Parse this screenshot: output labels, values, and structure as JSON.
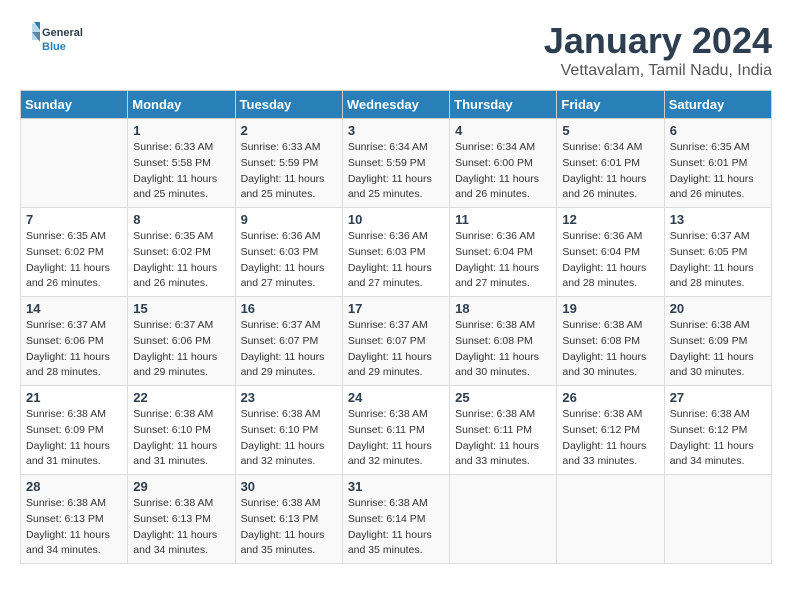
{
  "logo": {
    "general": "General",
    "blue": "Blue"
  },
  "title": "January 2024",
  "subtitle": "Vettavalam, Tamil Nadu, India",
  "days_header": [
    "Sunday",
    "Monday",
    "Tuesday",
    "Wednesday",
    "Thursday",
    "Friday",
    "Saturday"
  ],
  "weeks": [
    [
      {
        "day": "",
        "sunrise": "",
        "sunset": "",
        "daylight": ""
      },
      {
        "day": "1",
        "sunrise": "Sunrise: 6:33 AM",
        "sunset": "Sunset: 5:58 PM",
        "daylight": "Daylight: 11 hours and 25 minutes."
      },
      {
        "day": "2",
        "sunrise": "Sunrise: 6:33 AM",
        "sunset": "Sunset: 5:59 PM",
        "daylight": "Daylight: 11 hours and 25 minutes."
      },
      {
        "day": "3",
        "sunrise": "Sunrise: 6:34 AM",
        "sunset": "Sunset: 5:59 PM",
        "daylight": "Daylight: 11 hours and 25 minutes."
      },
      {
        "day": "4",
        "sunrise": "Sunrise: 6:34 AM",
        "sunset": "Sunset: 6:00 PM",
        "daylight": "Daylight: 11 hours and 26 minutes."
      },
      {
        "day": "5",
        "sunrise": "Sunrise: 6:34 AM",
        "sunset": "Sunset: 6:01 PM",
        "daylight": "Daylight: 11 hours and 26 minutes."
      },
      {
        "day": "6",
        "sunrise": "Sunrise: 6:35 AM",
        "sunset": "Sunset: 6:01 PM",
        "daylight": "Daylight: 11 hours and 26 minutes."
      }
    ],
    [
      {
        "day": "7",
        "sunrise": "Sunrise: 6:35 AM",
        "sunset": "Sunset: 6:02 PM",
        "daylight": "Daylight: 11 hours and 26 minutes."
      },
      {
        "day": "8",
        "sunrise": "Sunrise: 6:35 AM",
        "sunset": "Sunset: 6:02 PM",
        "daylight": "Daylight: 11 hours and 26 minutes."
      },
      {
        "day": "9",
        "sunrise": "Sunrise: 6:36 AM",
        "sunset": "Sunset: 6:03 PM",
        "daylight": "Daylight: 11 hours and 27 minutes."
      },
      {
        "day": "10",
        "sunrise": "Sunrise: 6:36 AM",
        "sunset": "Sunset: 6:03 PM",
        "daylight": "Daylight: 11 hours and 27 minutes."
      },
      {
        "day": "11",
        "sunrise": "Sunrise: 6:36 AM",
        "sunset": "Sunset: 6:04 PM",
        "daylight": "Daylight: 11 hours and 27 minutes."
      },
      {
        "day": "12",
        "sunrise": "Sunrise: 6:36 AM",
        "sunset": "Sunset: 6:04 PM",
        "daylight": "Daylight: 11 hours and 28 minutes."
      },
      {
        "day": "13",
        "sunrise": "Sunrise: 6:37 AM",
        "sunset": "Sunset: 6:05 PM",
        "daylight": "Daylight: 11 hours and 28 minutes."
      }
    ],
    [
      {
        "day": "14",
        "sunrise": "Sunrise: 6:37 AM",
        "sunset": "Sunset: 6:06 PM",
        "daylight": "Daylight: 11 hours and 28 minutes."
      },
      {
        "day": "15",
        "sunrise": "Sunrise: 6:37 AM",
        "sunset": "Sunset: 6:06 PM",
        "daylight": "Daylight: 11 hours and 29 minutes."
      },
      {
        "day": "16",
        "sunrise": "Sunrise: 6:37 AM",
        "sunset": "Sunset: 6:07 PM",
        "daylight": "Daylight: 11 hours and 29 minutes."
      },
      {
        "day": "17",
        "sunrise": "Sunrise: 6:37 AM",
        "sunset": "Sunset: 6:07 PM",
        "daylight": "Daylight: 11 hours and 29 minutes."
      },
      {
        "day": "18",
        "sunrise": "Sunrise: 6:38 AM",
        "sunset": "Sunset: 6:08 PM",
        "daylight": "Daylight: 11 hours and 30 minutes."
      },
      {
        "day": "19",
        "sunrise": "Sunrise: 6:38 AM",
        "sunset": "Sunset: 6:08 PM",
        "daylight": "Daylight: 11 hours and 30 minutes."
      },
      {
        "day": "20",
        "sunrise": "Sunrise: 6:38 AM",
        "sunset": "Sunset: 6:09 PM",
        "daylight": "Daylight: 11 hours and 30 minutes."
      }
    ],
    [
      {
        "day": "21",
        "sunrise": "Sunrise: 6:38 AM",
        "sunset": "Sunset: 6:09 PM",
        "daylight": "Daylight: 11 hours and 31 minutes."
      },
      {
        "day": "22",
        "sunrise": "Sunrise: 6:38 AM",
        "sunset": "Sunset: 6:10 PM",
        "daylight": "Daylight: 11 hours and 31 minutes."
      },
      {
        "day": "23",
        "sunrise": "Sunrise: 6:38 AM",
        "sunset": "Sunset: 6:10 PM",
        "daylight": "Daylight: 11 hours and 32 minutes."
      },
      {
        "day": "24",
        "sunrise": "Sunrise: 6:38 AM",
        "sunset": "Sunset: 6:11 PM",
        "daylight": "Daylight: 11 hours and 32 minutes."
      },
      {
        "day": "25",
        "sunrise": "Sunrise: 6:38 AM",
        "sunset": "Sunset: 6:11 PM",
        "daylight": "Daylight: 11 hours and 33 minutes."
      },
      {
        "day": "26",
        "sunrise": "Sunrise: 6:38 AM",
        "sunset": "Sunset: 6:12 PM",
        "daylight": "Daylight: 11 hours and 33 minutes."
      },
      {
        "day": "27",
        "sunrise": "Sunrise: 6:38 AM",
        "sunset": "Sunset: 6:12 PM",
        "daylight": "Daylight: 11 hours and 34 minutes."
      }
    ],
    [
      {
        "day": "28",
        "sunrise": "Sunrise: 6:38 AM",
        "sunset": "Sunset: 6:13 PM",
        "daylight": "Daylight: 11 hours and 34 minutes."
      },
      {
        "day": "29",
        "sunrise": "Sunrise: 6:38 AM",
        "sunset": "Sunset: 6:13 PM",
        "daylight": "Daylight: 11 hours and 34 minutes."
      },
      {
        "day": "30",
        "sunrise": "Sunrise: 6:38 AM",
        "sunset": "Sunset: 6:13 PM",
        "daylight": "Daylight: 11 hours and 35 minutes."
      },
      {
        "day": "31",
        "sunrise": "Sunrise: 6:38 AM",
        "sunset": "Sunset: 6:14 PM",
        "daylight": "Daylight: 11 hours and 35 minutes."
      },
      {
        "day": "",
        "sunrise": "",
        "sunset": "",
        "daylight": ""
      },
      {
        "day": "",
        "sunrise": "",
        "sunset": "",
        "daylight": ""
      },
      {
        "day": "",
        "sunrise": "",
        "sunset": "",
        "daylight": ""
      }
    ]
  ]
}
